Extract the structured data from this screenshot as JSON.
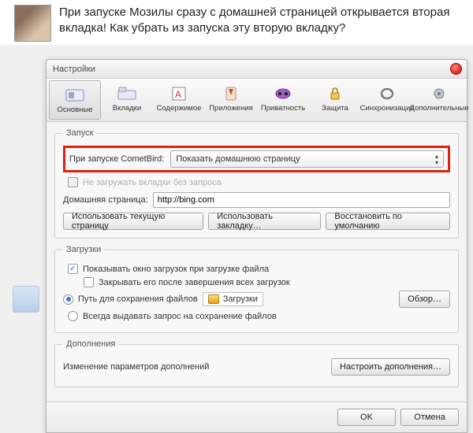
{
  "question_text": "При запуске Мозилы сразу с домашней страницей открывается вторая вкладка! Как убрать из запуска эту вторую вкладку?",
  "dialog": {
    "title": "Настройки",
    "toolbar": {
      "main": "Основные",
      "tabs": "Вкладки",
      "content": "Содержимое",
      "apps": "Приложения",
      "privacy": "Приватность",
      "security": "Защита",
      "sync": "Синхронизация",
      "advanced": "Дополнительные"
    },
    "startup": {
      "legend": "Запуск",
      "when_start_label": "При запуске CometBird:",
      "when_start_value": "Показать домашнюю страницу",
      "dont_load_label": "Не загружать вкладки без запроса",
      "home_label": "Домашняя страница:",
      "home_value": "http://bing.com",
      "btn_use_current": "Использовать текущую страницу",
      "btn_use_bookmark": "Использовать закладку…",
      "btn_restore": "Восстановить по умолчанию"
    },
    "downloads": {
      "legend": "Загрузки",
      "show_window": "Показывать окно загрузок при загрузке файла",
      "close_after": "Закрывать его после завершения всех загрузок",
      "save_to_label": "Путь для сохранения файлов",
      "save_to_value": "Загрузки",
      "browse": "Обзор…",
      "always_ask": "Всегда выдавать запрос на сохранение файлов"
    },
    "addons": {
      "legend": "Дополнения",
      "change_params": "Изменение параметров дополнений",
      "manage": "Настроить дополнения…"
    },
    "footer": {
      "ok": "OK",
      "cancel": "Отмена"
    }
  }
}
